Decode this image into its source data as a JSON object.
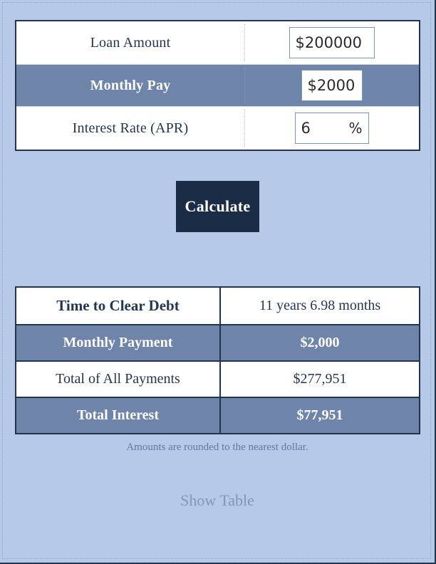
{
  "inputs": {
    "rows": [
      {
        "label": "Loan Amount",
        "value": "$200000",
        "placeholder": "$200000",
        "suffix": "",
        "shaded": false
      },
      {
        "label": "Monthly Pay",
        "value": "$2000",
        "placeholder": "$2000",
        "suffix": "",
        "shaded": true
      },
      {
        "label": "Interest Rate (APR)",
        "value": "6",
        "placeholder": "6",
        "suffix": "%",
        "shaded": false
      }
    ]
  },
  "actions": {
    "calculate_label": "Calculate",
    "show_table_label": "Show Table"
  },
  "results": {
    "rows": [
      {
        "label": "Time to Clear Debt",
        "value": "11 years 6.98 months"
      },
      {
        "label": "Monthly Payment",
        "value": "$2,000"
      },
      {
        "label": "Total of All Payments",
        "value": "$277,951"
      },
      {
        "label": "Total Interest",
        "value": "$77,951"
      }
    ]
  },
  "footer": {
    "rounding_note": "Amounts are rounded to the nearest dollar."
  },
  "colors": {
    "page_background": "#b6c9e8",
    "shaded_row": "#6e84a8",
    "border_dark": "#22354e",
    "button_background": "#1b2c46",
    "muted_text": "#8296b6"
  }
}
